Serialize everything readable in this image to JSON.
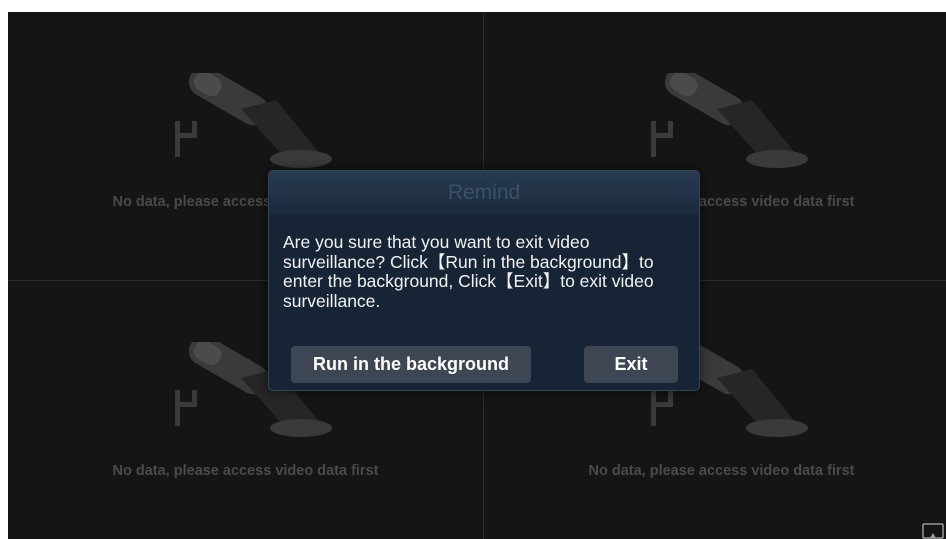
{
  "grid": {
    "cells": [
      {
        "message": "No data, please access video data first"
      },
      {
        "message": "No data, please access video data first"
      },
      {
        "message": "No data, please access video data first"
      },
      {
        "message": "No data, please access video data first"
      }
    ]
  },
  "dialog": {
    "title": "Remind",
    "message": "Are you sure that you want to exit video surveillance? Click【Run in the background】to enter the background, Click【Exit】to exit video surveillance.",
    "run_background_label": "Run in the background",
    "exit_label": "Exit"
  },
  "icons": {
    "cell_placeholder": "security-camera-icon",
    "corner": "cast-icon"
  },
  "colors": {
    "screen_background": "#151515",
    "dialog_background": "#172436",
    "button_background": "#3d4652",
    "placeholder_text": "#4a4a4a"
  }
}
